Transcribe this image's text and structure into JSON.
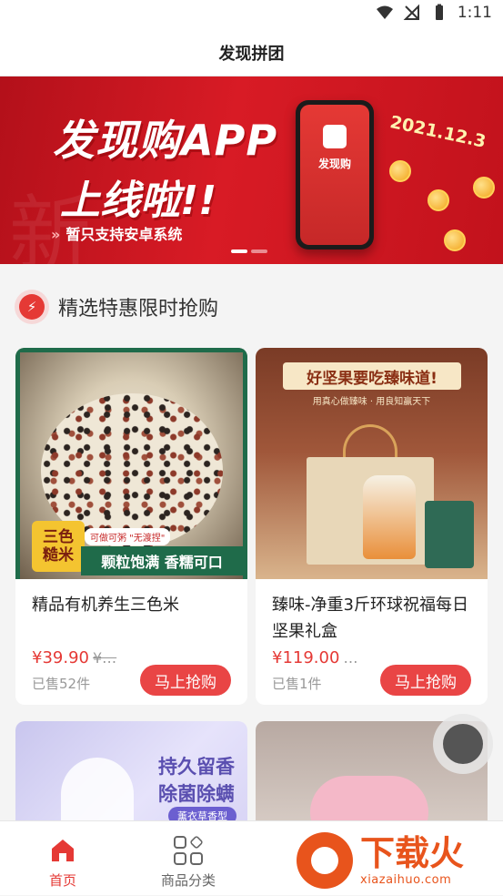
{
  "status_bar": {
    "time": "1:11"
  },
  "header": {
    "title": "发现拼团"
  },
  "banner": {
    "headline": "发现购APP",
    "subline": "上线啦!!",
    "tagline": "暂只支持安卓系统",
    "date": "2021.12.3",
    "app_name": "发现购"
  },
  "section": {
    "title": "精选特惠限时抢购"
  },
  "products": [
    {
      "name": "精品有机养生三色米",
      "price": "¥39.90",
      "old_price": "¥…",
      "sold": "已售52件",
      "buy_label": "马上抢购",
      "image_badge": [
        "三色",
        "糙米"
      ],
      "image_strip": "颗粒饱满  香糯可口",
      "image_tip": "可做可粥 \"无渡捏\""
    },
    {
      "name": "臻味-净重3斤环球祝福每日坚果礼盒",
      "price": "¥119.00",
      "old_price": "…",
      "sold": "已售1件",
      "buy_label": "马上抢购",
      "image_headline": "好坚果要吃臻味道!",
      "image_slogan": "用真心做臻味 · 用良知赢天下"
    },
    {
      "image_line1": "持久留香",
      "image_line2": "除菌除螨",
      "image_tag": "薰衣草香型"
    },
    {}
  ],
  "tabbar": {
    "items": [
      {
        "label": "首页",
        "icon": "home-icon",
        "active": true
      },
      {
        "label": "商品分类",
        "icon": "grid-icon",
        "active": false
      }
    ]
  },
  "watermark": {
    "brand": "下载火",
    "url": "xiazaihuo.com"
  },
  "colors": {
    "accent": "#e53935",
    "button": "#e94545"
  }
}
